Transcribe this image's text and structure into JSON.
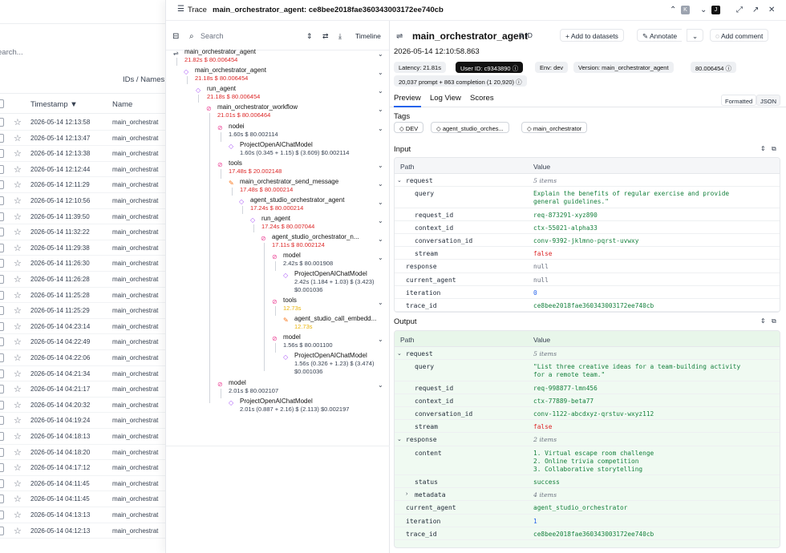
{
  "list": {
    "search_placeholder": "earch...",
    "ids_label": "IDs / Names",
    "col_timestamp": "Timestamp ▼",
    "col_name": "Name",
    "rows": [
      {
        "ts": "2026-05-14 12:13:58",
        "name": "main_orchestrat"
      },
      {
        "ts": "2026-05-14 12:13:47",
        "name": "main_orchestrat"
      },
      {
        "ts": "2026-05-14 12:13:38",
        "name": "main_orchestrat"
      },
      {
        "ts": "2026-05-14 12:12:44",
        "name": "main_orchestrat"
      },
      {
        "ts": "2026-05-14 12:11:29",
        "name": "main_orchestrat"
      },
      {
        "ts": "2026-05-14 12:10:56",
        "name": "main_orchestrat"
      },
      {
        "ts": "2026-05-14 11:39:50",
        "name": "main_orchestrat"
      },
      {
        "ts": "2026-05-14 11:32:22",
        "name": "main_orchestrat"
      },
      {
        "ts": "2026-05-14 11:29:38",
        "name": "main_orchestrat"
      },
      {
        "ts": "2026-05-14 11:26:30",
        "name": "main_orchestrat"
      },
      {
        "ts": "2026-05-14 11:26:28",
        "name": "main_orchestrat"
      },
      {
        "ts": "2026-05-14 11:25:28",
        "name": "main_orchestrat"
      },
      {
        "ts": "2026-05-14 11:25:29",
        "name": "main_orchestrat"
      },
      {
        "ts": "2026-05-14 04:23:14",
        "name": "main_orchestrat"
      },
      {
        "ts": "2026-05-14 04:22:49",
        "name": "main_orchestrat"
      },
      {
        "ts": "2026-05-14 04:22:06",
        "name": "main_orchestrat"
      },
      {
        "ts": "2026-05-14 04:21:34",
        "name": "main_orchestrat"
      },
      {
        "ts": "2026-05-14 04:21:17",
        "name": "main_orchestrat"
      },
      {
        "ts": "2026-05-14 04:20:32",
        "name": "main_orchestrat"
      },
      {
        "ts": "2026-05-14 04:19:24",
        "name": "main_orchestrat"
      },
      {
        "ts": "2026-05-14 04:18:13",
        "name": "main_orchestrat"
      },
      {
        "ts": "2026-05-14 04:18:20",
        "name": "main_orchestrat"
      },
      {
        "ts": "2026-05-14 04:17:12",
        "name": "main_orchestrat"
      },
      {
        "ts": "2026-05-14 04:11:45",
        "name": "main_orchestrat"
      },
      {
        "ts": "2026-05-14 04:11:45",
        "name": "main_orchestrat"
      },
      {
        "ts": "2026-05-14 04:13:13",
        "name": "main_orchestrat"
      },
      {
        "ts": "2026-05-14 04:12:13",
        "name": "main_orchestrat"
      }
    ]
  },
  "header": {
    "trace_label": "Trace",
    "trace_title": "main_orchestrator_agent: ce8bee2018fae360343003172ee740cb",
    "kbd_k": "K",
    "kbd_j": "J"
  },
  "tree": {
    "search_label": "Search",
    "timeline_label": "Timeline",
    "nodes": [
      {
        "name": "main_orchestrator_agent",
        "meta": "21.82s  $ 80.006454",
        "meta2": ""
      },
      {
        "name": "main_orchestrator_agent",
        "meta": "21.18s  $ 80.006454",
        "meta2": ""
      },
      {
        "name": "run_agent",
        "meta": "21.18s  $ 80.006454",
        "meta2": ""
      },
      {
        "name": "main_orchestrator_workflow",
        "meta": "21.01s  $ 80.006464",
        "meta2": ""
      },
      {
        "name": "nodei",
        "meta": "1.60s  $ 80.002114",
        "meta2": ""
      },
      {
        "name": "ProjectOpenAIChatModel",
        "meta": "1.60s  (0.345 + 1.15) $ (3.609)  $0.002114",
        "meta2": ""
      },
      {
        "name": "tools",
        "meta": "17.48s  $ 20.002148",
        "meta2": ""
      },
      {
        "name": "main_orchestrator_send_message",
        "meta": "17.48s  $ 80.000214",
        "meta2": ""
      },
      {
        "name": "agent_studio_orchestrator_agent",
        "meta": "17.24s  $ 80.000214",
        "meta2": ""
      },
      {
        "name": "run_agent",
        "meta": "17.24s  $ 80.007044",
        "meta2": ""
      },
      {
        "name": "agent_studio_orchestrator_n...",
        "meta": "17.11s  $ 80.002124",
        "meta2": ""
      },
      {
        "name": "model",
        "meta": "2.42s  $ 80.001908",
        "meta2": ""
      },
      {
        "name": "ProjectOpenAIChatModel",
        "meta": "2.42s  (1.184 + 1.03) $ (3.423)",
        "meta2": "$0.001036"
      },
      {
        "name": "tools",
        "meta": "12.73s",
        "meta2": ""
      },
      {
        "name": "agent_studio_call_embedd...",
        "meta": "12.73s",
        "meta2": ""
      },
      {
        "name": "model",
        "meta": "1.56s  $ 80.001100",
        "meta2": ""
      },
      {
        "name": "ProjectOpenAIChatModel",
        "meta": "1.56s  (0.326 + 1.23) $ (3.474)",
        "meta2": "$0.001036"
      },
      {
        "name": "model",
        "meta": "2.01s  $ 80.002107",
        "meta2": ""
      },
      {
        "name": "ProjectOpenAIChatModel",
        "meta": "2.01s  (0.887 + 2.16) $ (2.113)  $0.002197",
        "meta2": ""
      }
    ]
  },
  "detail": {
    "title": "main_orchestrator_agent",
    "id_label": "ID",
    "add_datasets": "+  Add to datasets",
    "annotate": "Annotate",
    "add_comment": "Add comment",
    "datetime": "2026-05-14 12:10:58.863",
    "chips": {
      "latency": "Latency: 21.81s",
      "user": "User ID: c9343890 ⓘ",
      "env": "Env: dev",
      "version": "Version: main_orchestrator_agent",
      "cost": "80.006454 ⓘ",
      "tokens": "20,037 prompt + 863 completion (1 20,920) ⓘ"
    },
    "tabs": {
      "preview": "Preview",
      "log": "Log View",
      "scores": "Scores",
      "formatted": "Formatted",
      "json": "JSON"
    },
    "tags_label": "Tags",
    "tags": [
      "DEV",
      "agent_studio_orches...",
      "main_orchestrator"
    ],
    "input_label": "Input",
    "output_label": "Output",
    "path_col": "Path",
    "value_col": "Value",
    "input_rows": [
      {
        "k": "request",
        "v": "5 items",
        "t": "it",
        "ind": 0,
        "caret": "⌄"
      },
      {
        "k": "query",
        "v": "Explain the benefits of regular exercise and provide\ngeneral guidelines.\"",
        "t": "str",
        "ind": 1
      },
      {
        "k": "request_id",
        "v": "req-873291-xyz890",
        "t": "str",
        "ind": 1
      },
      {
        "k": "context_id",
        "v": "ctx-55021-alpha33",
        "t": "str",
        "ind": 1
      },
      {
        "k": "conversation_id",
        "v": "conv-9392-jklmno-pqrst-uvwxy",
        "t": "str",
        "ind": 1
      },
      {
        "k": "stream",
        "v": "false",
        "t": "bool",
        "ind": 1
      },
      {
        "k": "response",
        "v": "null",
        "t": "gray",
        "ind": 0
      },
      {
        "k": "current_agent",
        "v": "null",
        "t": "gray",
        "ind": 0
      },
      {
        "k": "iteration",
        "v": "0",
        "t": "num",
        "ind": 0
      },
      {
        "k": "trace_id",
        "v": "ce8bee2018fae360343003172ee740cb",
        "t": "str",
        "ind": 0
      }
    ],
    "output_rows": [
      {
        "k": "request",
        "v": "5 items",
        "t": "it",
        "ind": 0,
        "caret": "⌄"
      },
      {
        "k": "query",
        "v": "\"List three creative ideas for a team-building activity\nfor a remote team.\"",
        "t": "str",
        "ind": 1
      },
      {
        "k": "request_id",
        "v": "req-998877-lmn456",
        "t": "str",
        "ind": 1
      },
      {
        "k": "context_id",
        "v": "ctx-77889-beta77",
        "t": "str",
        "ind": 1
      },
      {
        "k": "conversation_id",
        "v": "conv-1122-abcdxyz-qrstuv-wxyz112",
        "t": "str",
        "ind": 1
      },
      {
        "k": "stream",
        "v": "false",
        "t": "bool",
        "ind": 1
      },
      {
        "k": "response",
        "v": "2 items",
        "t": "it",
        "ind": 0,
        "caret": "⌄"
      },
      {
        "k": "content",
        "v": "1. Virtual escape room challenge\n2. Online trivia competition\n3. Collaborative storytelling",
        "t": "str",
        "ind": 1
      },
      {
        "k": "status",
        "v": "success",
        "t": "str",
        "ind": 1
      },
      {
        "k": "metadata",
        "v": "4 items",
        "t": "it",
        "ind": 1,
        "caret": "›"
      },
      {
        "k": "current_agent",
        "v": "agent_studio_orchestrator",
        "t": "str",
        "ind": 0
      },
      {
        "k": "iteration",
        "v": "1",
        "t": "num",
        "ind": 0
      },
      {
        "k": "trace_id",
        "v": "ce8bee2018fae360343003172ee740cb",
        "t": "str",
        "ind": 0
      }
    ]
  }
}
